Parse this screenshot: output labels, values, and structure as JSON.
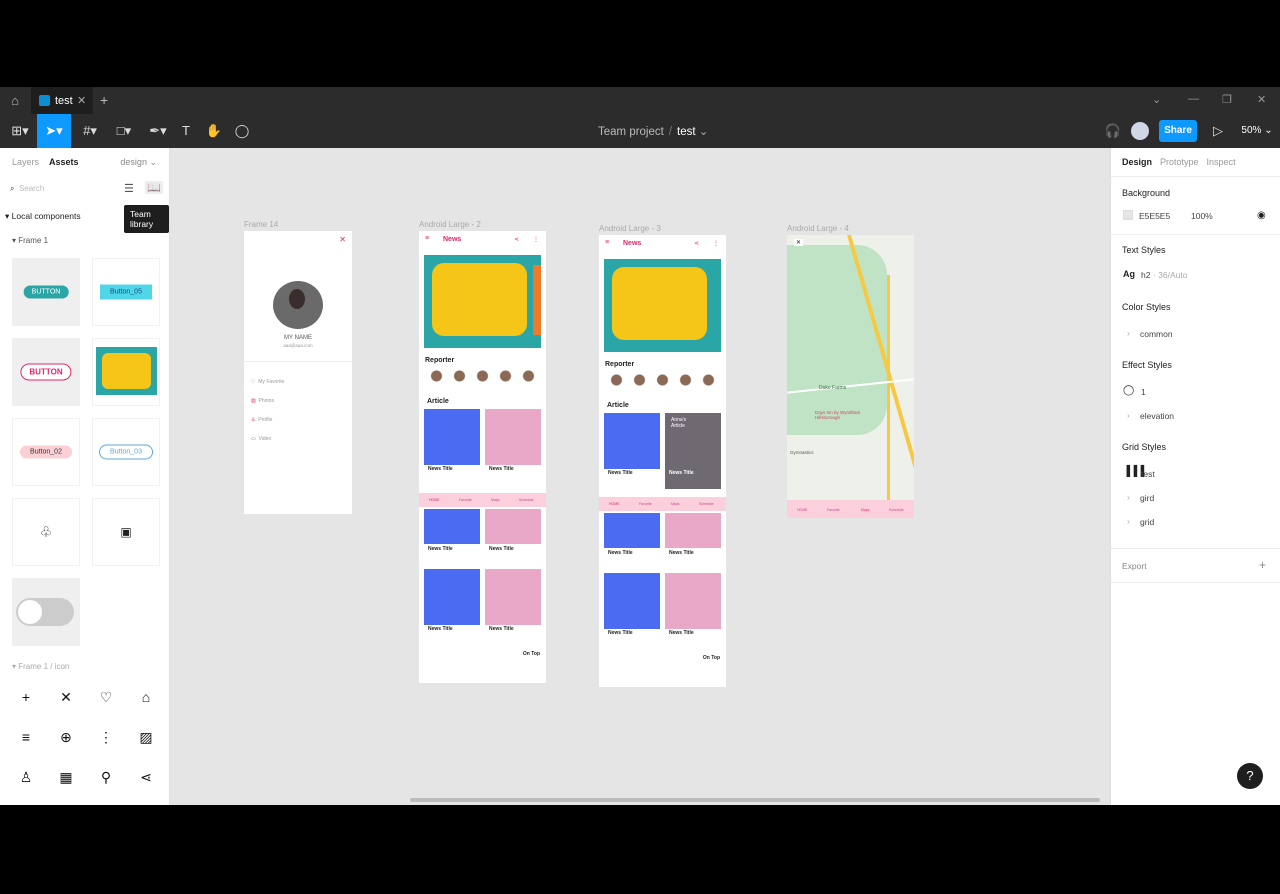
{
  "titlebar": {
    "tab_title": "test",
    "tab_close": "✕",
    "new_tab": "+"
  },
  "toolbar": {
    "project": "Team project",
    "separator": "/",
    "file": "test",
    "share": "Share",
    "zoom": "50%"
  },
  "left_panel": {
    "tabs": [
      "Layers",
      "Assets"
    ],
    "page_select": "design",
    "search_placeholder": "Search",
    "tooltip": "Team library",
    "local_components": "Local components",
    "frame1": "Frame 1",
    "frame1_icon": "Frame 1 / icon",
    "components": [
      "BUTTON",
      "Button_05",
      "BUTTON",
      "Button_02",
      "Button_03"
    ]
  },
  "canvas": {
    "frame14": {
      "label": "Frame 14",
      "name": "MY NAME",
      "email": "aaa@aaa.com",
      "menu": [
        "My Favorite",
        "Photos",
        "Profile",
        "Video"
      ]
    },
    "android2": {
      "label": "Android Large - 2"
    },
    "android3": {
      "label": "Android Large - 3"
    },
    "android4": {
      "label": "Android Large - 4",
      "place1": "Duke Farms",
      "place2": "Days Inn by Wyndham Hillsborough",
      "place3": "Gymnastics"
    },
    "news": "News",
    "reporter": "Reporter",
    "article": "Article",
    "news_title": "News Title",
    "on_top": "On Top",
    "annas_article": "Anna's Article",
    "nav": [
      "HOME",
      "Favorite",
      "Maps",
      "Schedule"
    ]
  },
  "right_panel": {
    "tabs": [
      "Design",
      "Prototype",
      "Inspect"
    ],
    "background": "Background",
    "bg_hex": "E5E5E5",
    "bg_opacity": "100%",
    "text_styles": "Text Styles",
    "text_style_name": "h2",
    "text_style_meta": "· 36/Auto",
    "color_styles": "Color Styles",
    "color_common": "common",
    "effect_styles": "Effect Styles",
    "effect_1": "1",
    "effect_elevation": "elevation",
    "grid_styles": "Grid Styles",
    "grid_test": "test",
    "grid_gird": "gird",
    "grid_grid": "grid",
    "export": "Export"
  },
  "colors": {
    "accent": "#0d99ff",
    "pink": "#e2256c",
    "teal": "#2aa6a6",
    "yellow": "#f5c518"
  }
}
